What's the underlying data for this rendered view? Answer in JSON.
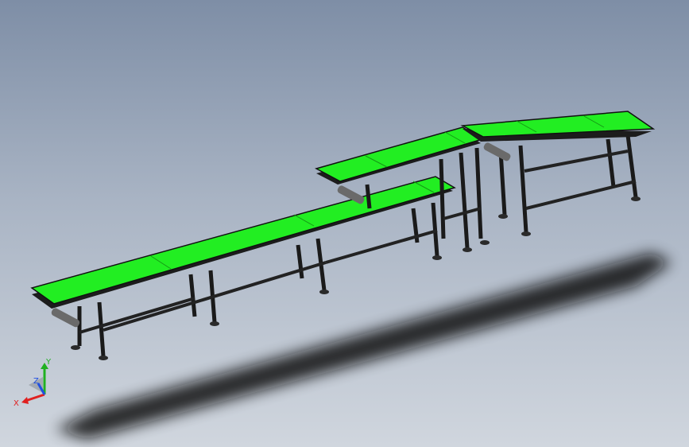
{
  "viewport": {
    "background_top": "#7e8ea6",
    "background_bottom": "#d0d6de",
    "belt_color": "#22ee22",
    "frame_color": "#1c1c1c",
    "shadow_color": "#0d0d0d"
  },
  "model": {
    "description_icon": "conveyor-assembly-3d"
  },
  "triad": {
    "x_label": "X",
    "y_label": "Y",
    "z_label": "Z",
    "x_color": "#e02020",
    "y_color": "#20b020",
    "z_color": "#2050e0"
  }
}
